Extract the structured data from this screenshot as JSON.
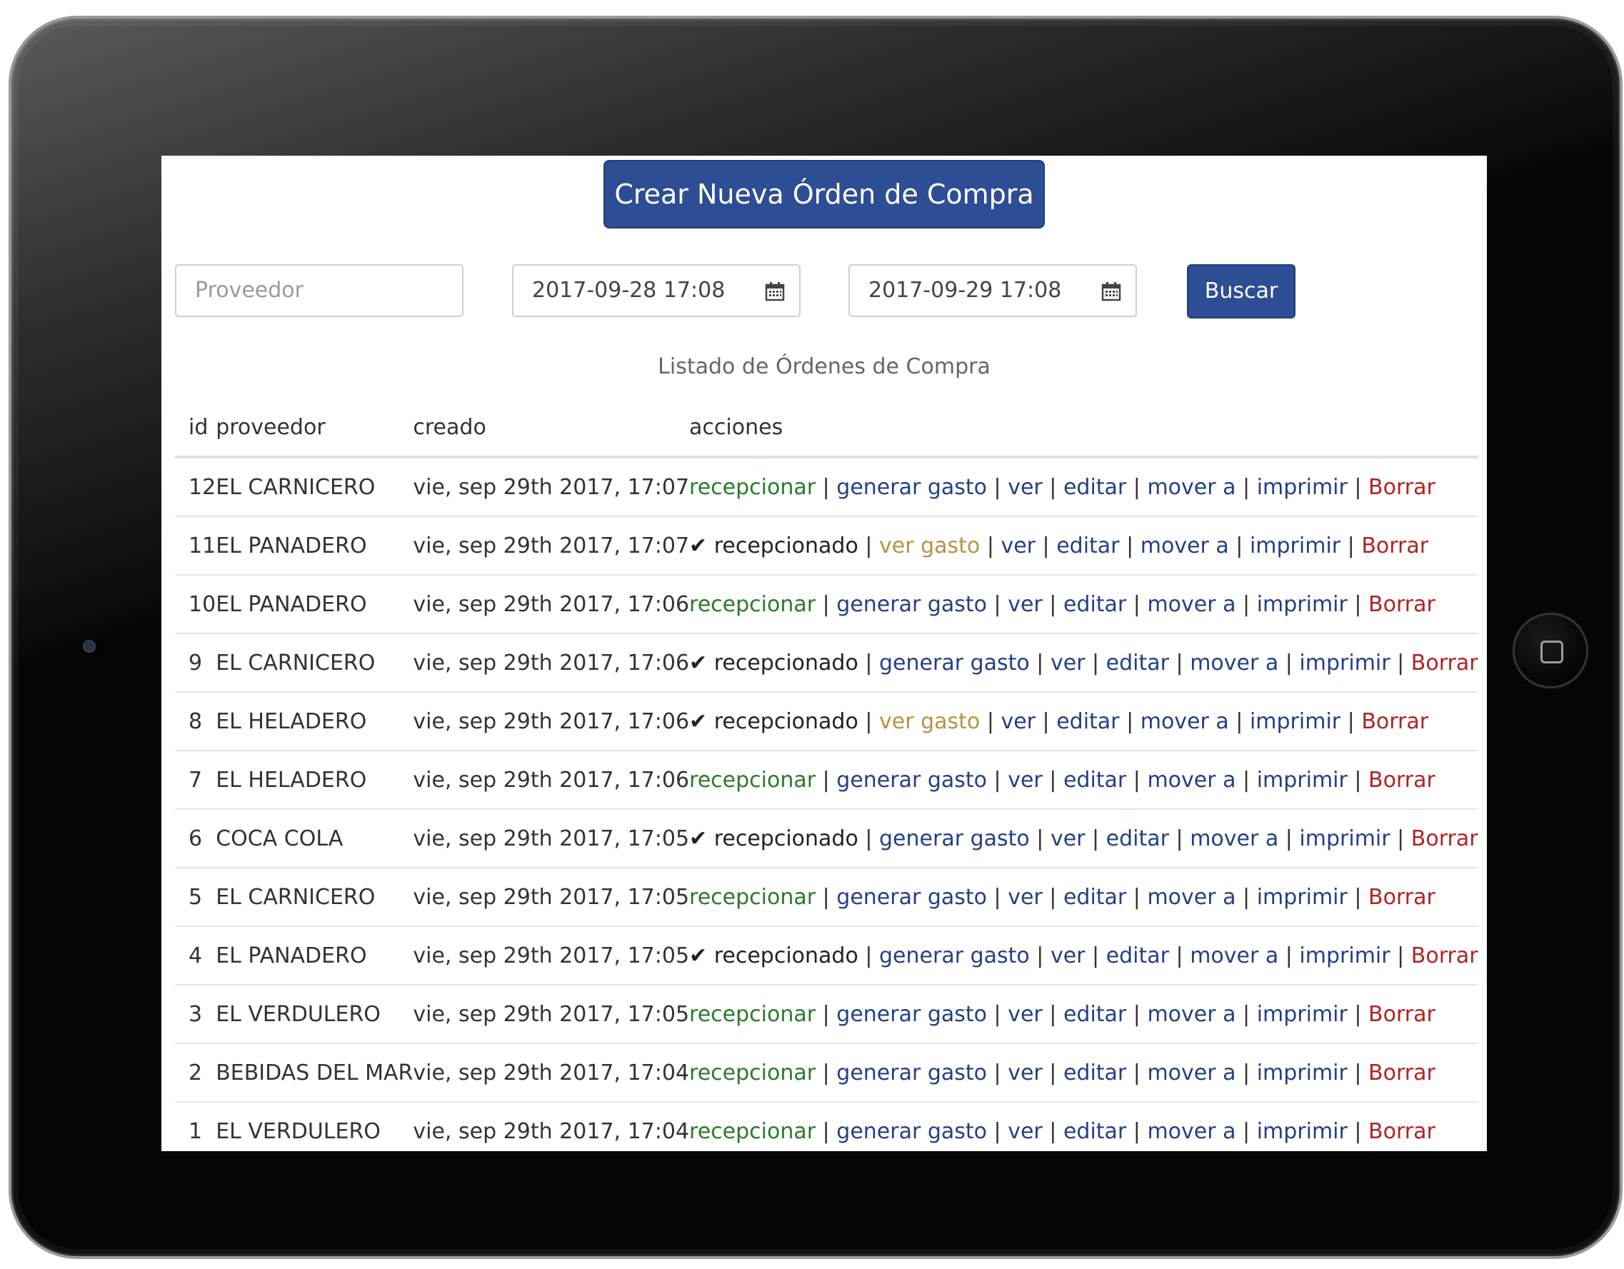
{
  "header": {
    "create_button": "Crear Nueva Órden de Compra"
  },
  "filters": {
    "provider_placeholder": "Proveedor",
    "date_from": "2017-09-28 17:08",
    "date_to": "2017-09-29 17:08",
    "search_button": "Buscar"
  },
  "list_title": "Listado de Órdenes de Compra",
  "table": {
    "columns": [
      "id",
      "proveedor",
      "creado",
      "acciones"
    ],
    "rows": [
      {
        "id": "12",
        "proveedor": "EL CARNICERO",
        "creado": "vie, sep 29th 2017, 17:07",
        "received": false,
        "expense_generated": false
      },
      {
        "id": "11",
        "proveedor": "EL PANADERO",
        "creado": "vie, sep 29th 2017, 17:07",
        "received": true,
        "expense_generated": true
      },
      {
        "id": "10",
        "proveedor": "EL PANADERO",
        "creado": "vie, sep 29th 2017, 17:06",
        "received": false,
        "expense_generated": false
      },
      {
        "id": "9",
        "proveedor": "EL CARNICERO",
        "creado": "vie, sep 29th 2017, 17:06",
        "received": true,
        "expense_generated": false
      },
      {
        "id": "8",
        "proveedor": "EL HELADERO",
        "creado": "vie, sep 29th 2017, 17:06",
        "received": true,
        "expense_generated": true
      },
      {
        "id": "7",
        "proveedor": "EL HELADERO",
        "creado": "vie, sep 29th 2017, 17:06",
        "received": false,
        "expense_generated": false
      },
      {
        "id": "6",
        "proveedor": "COCA COLA",
        "creado": "vie, sep 29th 2017, 17:05",
        "received": true,
        "expense_generated": false
      },
      {
        "id": "5",
        "proveedor": "EL CARNICERO",
        "creado": "vie, sep 29th 2017, 17:05",
        "received": false,
        "expense_generated": false
      },
      {
        "id": "4",
        "proveedor": "EL PANADERO",
        "creado": "vie, sep 29th 2017, 17:05",
        "received": true,
        "expense_generated": false
      },
      {
        "id": "3",
        "proveedor": "EL VERDULERO",
        "creado": "vie, sep 29th 2017, 17:05",
        "received": false,
        "expense_generated": false
      },
      {
        "id": "2",
        "proveedor": "BEBIDAS DEL MAR",
        "creado": "vie, sep 29th 2017, 17:04",
        "received": false,
        "expense_generated": false
      },
      {
        "id": "1",
        "proveedor": "EL VERDULERO",
        "creado": "vie, sep 29th 2017, 17:04",
        "received": false,
        "expense_generated": false
      }
    ]
  },
  "actions": {
    "receive": "recepcionar",
    "received": "✔ recepcionado",
    "generate_expense": "generar gasto",
    "view_expense": "ver gasto",
    "view": "ver",
    "edit": "editar",
    "move_to": "mover a",
    "print": "imprimir",
    "delete": "Borrar",
    "separator": " | "
  },
  "colors": {
    "primary_button": "#2d4d95",
    "action_receive": "#2a7a2a",
    "action_link": "#243f86",
    "action_view_expense": "#b89242",
    "action_delete": "#b22222"
  }
}
